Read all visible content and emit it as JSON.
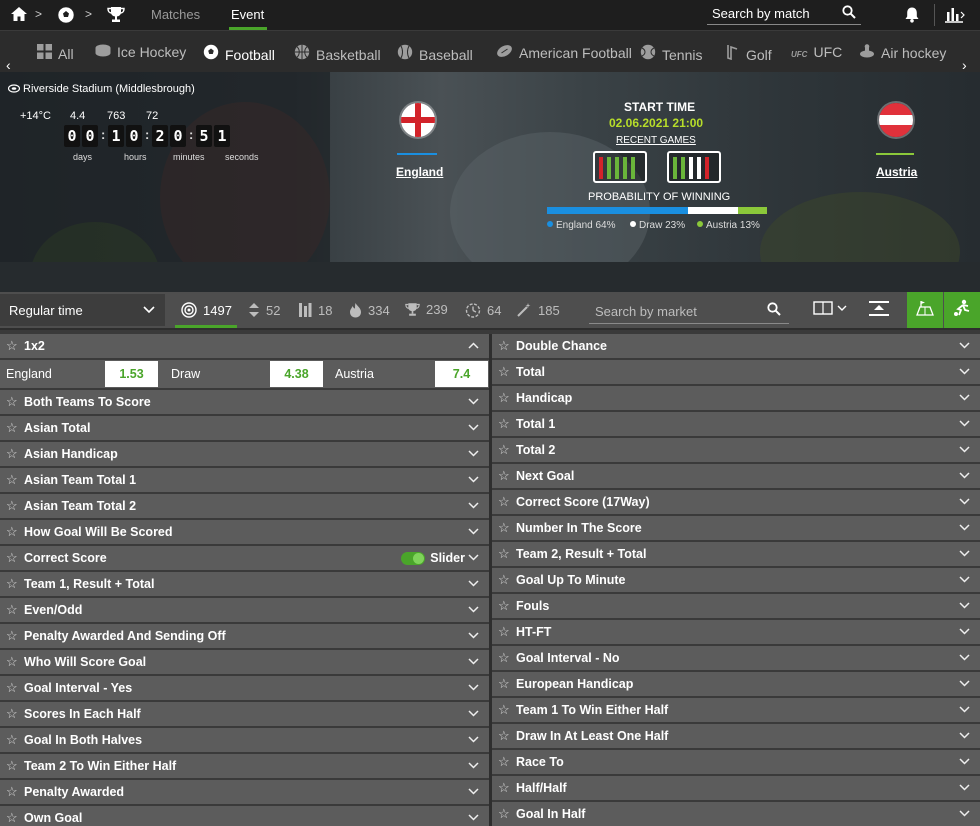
{
  "topbar": {
    "home_icon": "home-icon",
    "ball_icon": "football-icon",
    "trophy_icon": "trophy-icon",
    "matches_label": "Matches",
    "event_label": "Event",
    "search_placeholder": "Search by match",
    "accent": "#4aa52a"
  },
  "sports": [
    {
      "label": "All",
      "icon": "grid-icon"
    },
    {
      "label": "Ice Hockey",
      "icon": "puck-icon"
    },
    {
      "label": "Football",
      "icon": "football-icon",
      "active": true
    },
    {
      "label": "Basketball",
      "icon": "basketball-icon"
    },
    {
      "label": "Baseball",
      "icon": "baseball-icon"
    },
    {
      "label": "American Football",
      "icon": "american-football-icon"
    },
    {
      "label": "Tennis",
      "icon": "tennis-icon"
    },
    {
      "label": "Golf",
      "icon": "golf-icon"
    },
    {
      "label": "UFC",
      "icon": "ufc-icon"
    },
    {
      "label": "Air hockey",
      "icon": "air-hockey-icon"
    }
  ],
  "event": {
    "stadium": "Riverside Stadium (Middlesbrough)",
    "temperature": "+14°C",
    "weather": [
      "4.4",
      "763",
      "72"
    ],
    "countdown_digits": [
      "0",
      "0",
      "1",
      "0",
      "2",
      "0",
      "5",
      "1"
    ],
    "countdown_labels": [
      "days",
      "hours",
      "minutes",
      "seconds"
    ],
    "home_team": "England",
    "away_team": "Austria",
    "start_label": "START TIME",
    "start_time": "02.06.2021 21:00",
    "recent_games_label": "RECENT GAMES",
    "home_form": [
      "L",
      "W",
      "W",
      "W",
      "W"
    ],
    "away_form": [
      "W",
      "W",
      "D",
      "D",
      "L"
    ],
    "probability_label": "PROBABILITY OF WINNING",
    "probabilities": [
      {
        "label": "England 64%",
        "value": 64,
        "color": "#1a8fe0"
      },
      {
        "label": "Draw 23%",
        "value": 23,
        "color": "#ffffff"
      },
      {
        "label": "Austria 13%",
        "value": 13,
        "color": "#8bc83a"
      }
    ]
  },
  "filters": {
    "period": "Regular time",
    "stats": [
      {
        "value": "1497",
        "icon": "target-icon",
        "active": true
      },
      {
        "value": "52",
        "icon": "up-down-icon"
      },
      {
        "value": "18",
        "icon": "bars-icon"
      },
      {
        "value": "334",
        "icon": "fire-icon"
      },
      {
        "value": "239",
        "icon": "trophy-icon"
      },
      {
        "value": "64",
        "icon": "timer-icon"
      },
      {
        "value": "185",
        "icon": "magic-wand-icon"
      }
    ],
    "market_search_placeholder": "Search by market"
  },
  "main_market": {
    "title": "1x2",
    "odds": [
      {
        "name": "England",
        "value": "1.53"
      },
      {
        "name": "Draw",
        "value": "4.38"
      },
      {
        "name": "Austria",
        "value": "7.4"
      }
    ]
  },
  "left_markets": [
    "Both Teams To Score",
    "Asian Total",
    "Asian Handicap",
    "Asian Team Total 1",
    "Asian Team Total 2",
    "How Goal Will Be Scored",
    "Correct Score",
    "Team 1, Result + Total",
    "Even/Odd",
    "Penalty Awarded And Sending Off",
    "Who Will Score Goal",
    "Goal Interval - Yes",
    "Scores In Each Half",
    "Goal In Both Halves",
    "Team 2 To Win Either Half",
    "Penalty Awarded",
    "Own Goal"
  ],
  "correct_score_slider_label": "Slider",
  "right_markets": [
    "Double Chance",
    "Total",
    "Handicap",
    "Total 1",
    "Total 2",
    "Next Goal",
    "Correct Score (17Way)",
    "Number In The Score",
    "Team 2, Result + Total",
    "Goal Up To Minute",
    "Fouls",
    "HT-FT",
    "Goal Interval - No",
    "European Handicap",
    "Team 1 To Win Either Half",
    "Draw In At Least One Half",
    "Race To",
    "Half/Half",
    "Goal In Half"
  ]
}
